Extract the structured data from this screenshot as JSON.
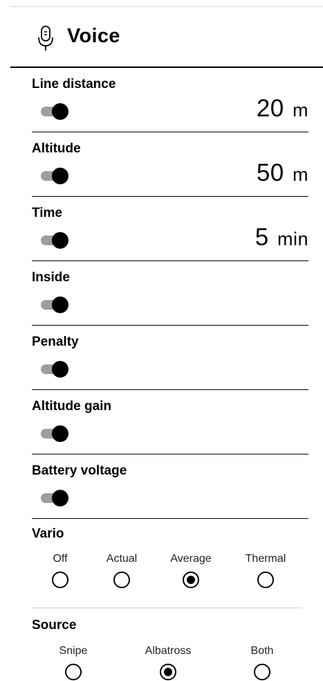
{
  "header": {
    "title": "Voice",
    "icon": "microphone-icon"
  },
  "rows": [
    {
      "label": "Line distance",
      "on": true,
      "value": "20",
      "unit": "m"
    },
    {
      "label": "Altitude",
      "on": true,
      "value": "50",
      "unit": "m"
    },
    {
      "label": "Time",
      "on": true,
      "value": "5",
      "unit": "min"
    },
    {
      "label": "Inside",
      "on": true
    },
    {
      "label": "Penalty",
      "on": true
    },
    {
      "label": "Altitude gain",
      "on": true
    },
    {
      "label": "Battery voltage",
      "on": true
    }
  ],
  "vario": {
    "label": "Vario",
    "options": [
      "Off",
      "Actual",
      "Average",
      "Thermal"
    ],
    "selected": "Average"
  },
  "source": {
    "label": "Source",
    "options": [
      "Snipe",
      "Albatross",
      "Both"
    ],
    "selected": "Albatross"
  }
}
